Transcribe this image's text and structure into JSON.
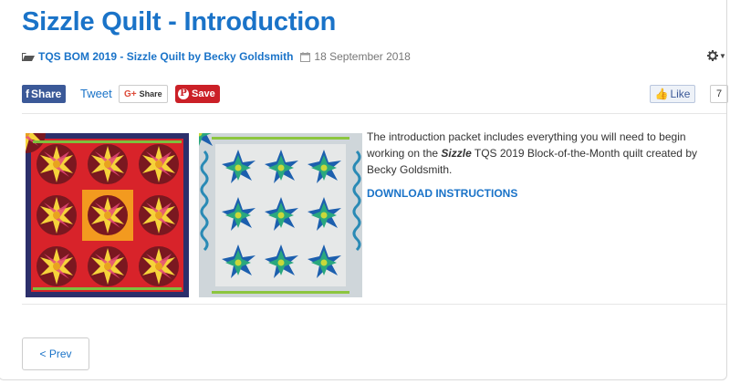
{
  "article": {
    "title": "Sizzle Quilt - Introduction",
    "category": "TQS BOM 2019 - Sizzle Quilt by Becky Goldsmith",
    "date": "18 September 2018"
  },
  "share": {
    "facebook_icon": "f",
    "facebook_label": "Share",
    "tweet_label": "Tweet",
    "gplus_icon": "G+",
    "gplus_label": "Share",
    "pinterest_icon": "P",
    "pinterest_label": "Save",
    "like_label": "Like",
    "like_count": "7"
  },
  "body": {
    "text_before": "The introduction packet includes everything you will need to begin working on the ",
    "emphasis": "Sizzle",
    "text_after": " TQS 2019 Block-of-the-Month quilt created by Becky Goldsmith.",
    "download_label": "DOWNLOAD INSTRUCTIONS"
  },
  "pagination": {
    "prev_label": "< Prev"
  },
  "colors": {
    "link": "#1a73c8",
    "facebook": "#3b5998",
    "pinterest": "#cb2027"
  },
  "icons": {
    "category": "folder-open-icon",
    "date": "calendar-icon",
    "tools": "gear-icon"
  }
}
